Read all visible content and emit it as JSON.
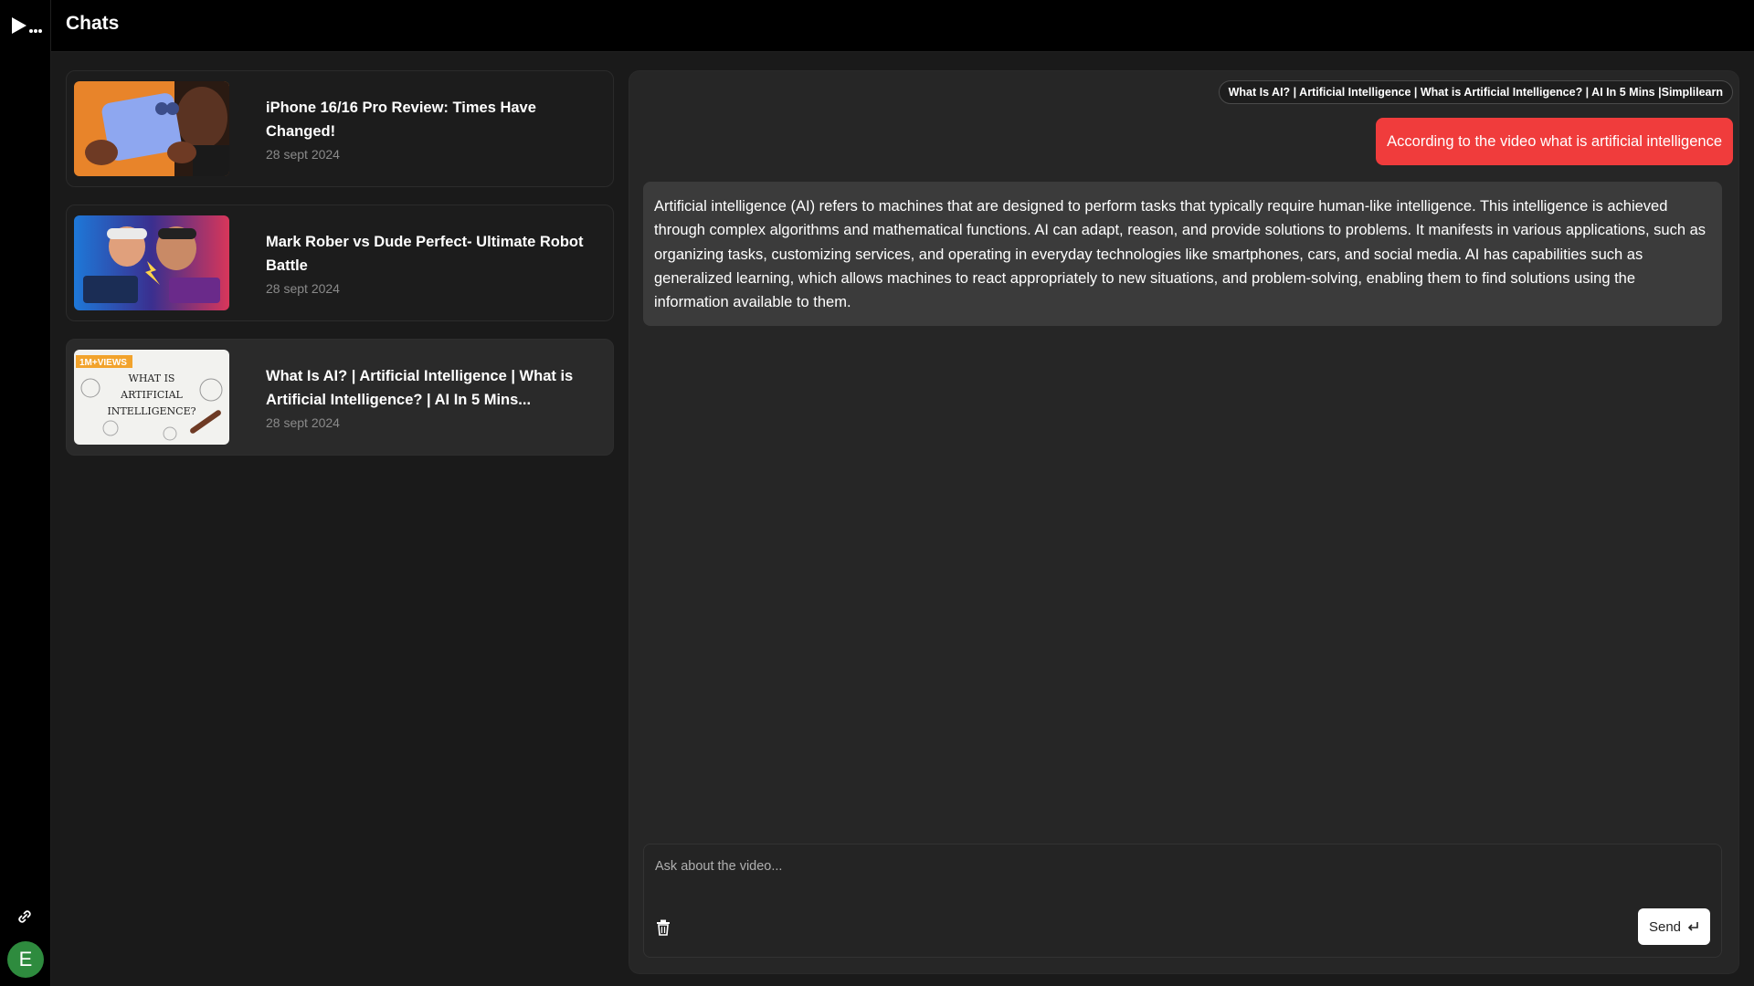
{
  "header": {
    "title": "Chats"
  },
  "rail": {
    "avatar_letter": "E",
    "logo_icon": "play-dots-logo",
    "link_icon": "link-icon"
  },
  "chats": [
    {
      "title": "iPhone 16/16 Pro Review: Times Have Changed!",
      "date": "28 sept 2024",
      "active": false
    },
    {
      "title": "Mark Rober vs Dude Perfect- Ultimate Robot Battle",
      "date": "28 sept 2024",
      "active": false
    },
    {
      "title": "What Is AI? | Artificial Intelligence | What is Artificial Intelligence? | AI In 5 Mins...",
      "date": "28 sept 2024",
      "active": true,
      "thumb_badge": "1M+VIEWS",
      "thumb_text": "WHAT IS ARTIFICIAL INTELLIGENCE?"
    }
  ],
  "conversation": {
    "video_title": "What Is AI? | Artificial Intelligence | What is Artificial Intelligence? | AI In 5 Mins |Simplilearn",
    "user_message": "According to the video what is artificial intelligence",
    "ai_message": "Artificial intelligence (AI) refers to machines that are designed to perform tasks that typically require human-like intelligence. This intelligence is achieved through complex algorithms and mathematical functions. AI can adapt, reason, and provide solutions to problems. It manifests in various applications, such as organizing tasks, customizing services, and operating in everyday technologies like smartphones, cars, and social media. AI has capabilities such as generalized learning, which allows machines to react appropriately to new situations, and problem-solving, enabling them to find solutions using the information available to them."
  },
  "input": {
    "placeholder": "Ask about the video...",
    "value": "",
    "send_label": "Send",
    "send_icon": "enter-icon",
    "clear_icon": "trash-icon"
  },
  "colors": {
    "accent": "#f03c3c",
    "background": "#1a1a1a",
    "panel": "#262626",
    "ai_bubble": "#3b3b3b",
    "avatar": "#2e8b3e"
  }
}
